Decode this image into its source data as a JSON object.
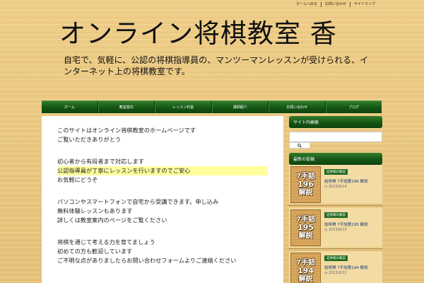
{
  "top_links": [
    "ホームへ戻る",
    "お問い合わせ",
    "サイトマップ"
  ],
  "header": {
    "title": "オンライン将棋教室 香",
    "description": "自宅で、気軽に、公認の将棋指導員の、マンツーマンレッスンが受けられる、インターネット上の将棋教室です。"
  },
  "nav": {
    "items": [
      "ホーム",
      "教室案内",
      "レッスン料金",
      "講師紹介",
      "お問い合わせ",
      "ブログ"
    ]
  },
  "content": {
    "paragraphs": [
      {
        "lines": [
          "このサイトはオンライン将棋教室のホームページです",
          "ご覧いただきありがとう"
        ]
      },
      {
        "lines": [
          "初心者から有段者まで対応します",
          "公認指導員が丁寧にレッスンを行いますのでご安心",
          "お気軽にどうぞ"
        ],
        "highlight": 1
      },
      {
        "lines": [
          "パソコンやスマートフォンで自宅から受講できます。申し込み",
          "無料体験レッスンもあります",
          "詳しくは教室案内のページをご覧ください"
        ]
      },
      {
        "lines": [
          "将棋を通じて考える力を育てましょう",
          "初めての方も歓迎しています",
          "ご不明な点がありましたらお問い合わせフォームよりご連絡ください"
        ]
      }
    ]
  },
  "sidebar": {
    "search_title": "サイト内検索",
    "search_icon": "magnifier-icon",
    "recent_title": "最新の投稿",
    "posts": [
      {
        "thumb": [
          "7手詰",
          "196",
          "解説"
        ],
        "category": "詰将棋の解説",
        "title": "詰将棋 7手詰第196 解説",
        "date": "2023/6/14"
      },
      {
        "thumb": [
          "7手詰",
          "195",
          "解説"
        ],
        "category": "詰将棋の解説",
        "title": "詰将棋 7手詰第195 解説",
        "date": "2023/6/13"
      },
      {
        "thumb": [
          "7手詰",
          "194",
          "解説"
        ],
        "category": "詰将棋の解説",
        "title": "詰将棋 7手詰第194 解説",
        "date": "2023/6/12"
      }
    ]
  },
  "colors": {
    "nav_green": "#155515",
    "highlight": "#ffff9e",
    "wood": "#e8c47c"
  }
}
